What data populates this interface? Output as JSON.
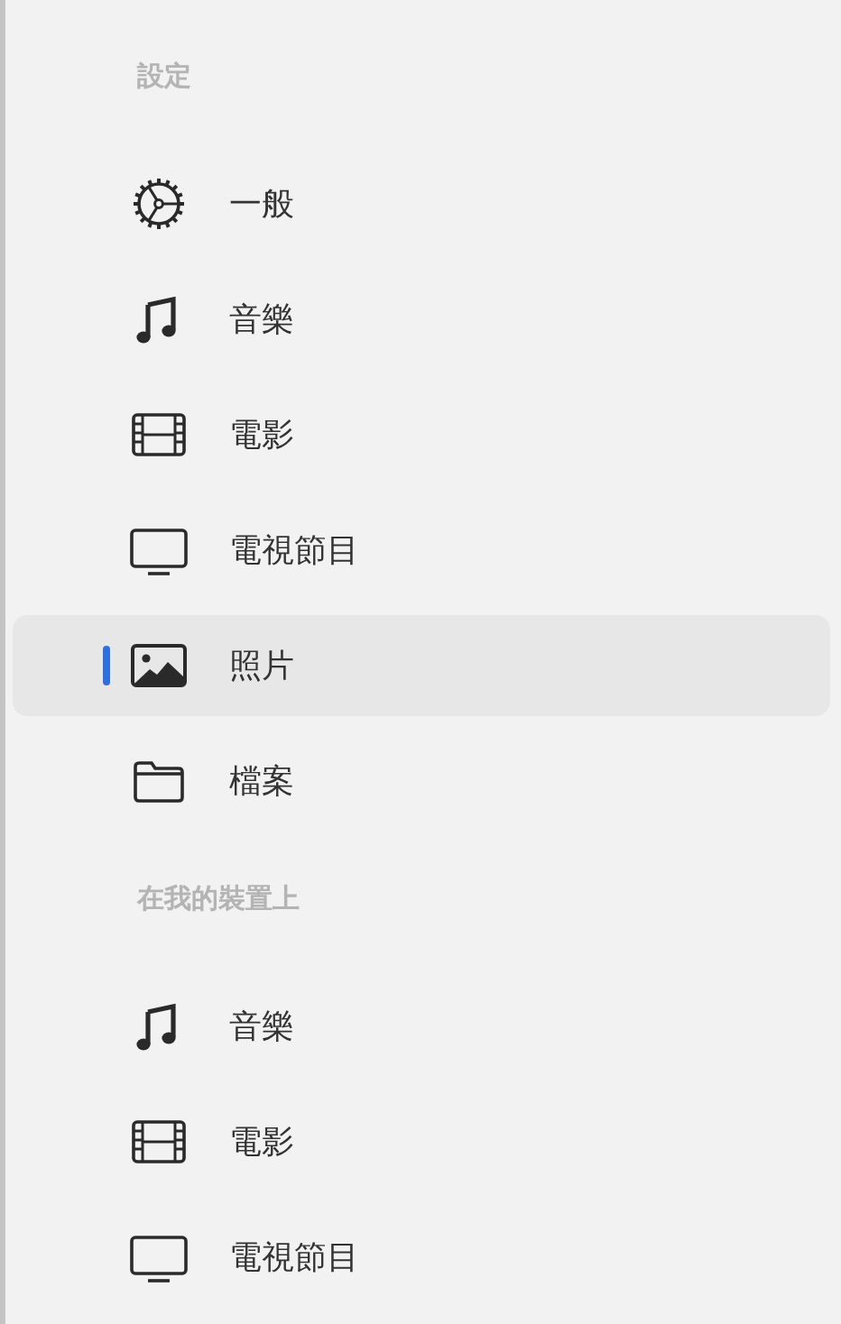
{
  "sections": [
    {
      "heading": "設定",
      "items": [
        {
          "label": "一般",
          "kind": "gear",
          "selected": false
        },
        {
          "label": "音樂",
          "kind": "note",
          "selected": false
        },
        {
          "label": "電影",
          "kind": "film",
          "selected": false
        },
        {
          "label": "電視節目",
          "kind": "tv",
          "selected": false
        },
        {
          "label": "照片",
          "kind": "photo",
          "selected": true
        },
        {
          "label": "檔案",
          "kind": "folder",
          "selected": false
        }
      ]
    },
    {
      "heading": "在我的裝置上",
      "items": [
        {
          "label": "音樂",
          "kind": "note",
          "selected": false
        },
        {
          "label": "電影",
          "kind": "film",
          "selected": false
        },
        {
          "label": "電視節目",
          "kind": "tv",
          "selected": false
        }
      ]
    }
  ]
}
